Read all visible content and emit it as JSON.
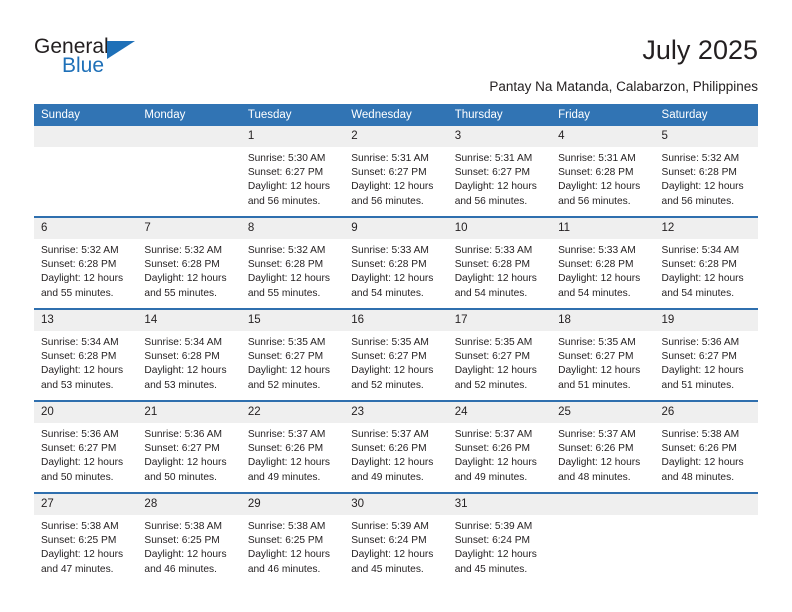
{
  "brand": {
    "name_part1": "General",
    "name_part2": "Blue",
    "triangle_icon": "triangle-icon",
    "accent_color": "#1e70b8"
  },
  "header": {
    "title": "July 2025",
    "subtitle": "Pantay Na Matanda, Calabarzon, Philippines",
    "header_bg_color": "#3174b4",
    "row_divider_color": "#2f6fae",
    "daynum_bg_color": "#efefef"
  },
  "weekday_headers": [
    "Sunday",
    "Monday",
    "Tuesday",
    "Wednesday",
    "Thursday",
    "Friday",
    "Saturday"
  ],
  "weeks": [
    [
      {
        "day": "",
        "empty": true
      },
      {
        "day": "",
        "empty": true
      },
      {
        "day": "1",
        "sunrise": "Sunrise: 5:30 AM",
        "sunset": "Sunset: 6:27 PM",
        "daylight1": "Daylight: 12 hours",
        "daylight2": "and 56 minutes."
      },
      {
        "day": "2",
        "sunrise": "Sunrise: 5:31 AM",
        "sunset": "Sunset: 6:27 PM",
        "daylight1": "Daylight: 12 hours",
        "daylight2": "and 56 minutes."
      },
      {
        "day": "3",
        "sunrise": "Sunrise: 5:31 AM",
        "sunset": "Sunset: 6:27 PM",
        "daylight1": "Daylight: 12 hours",
        "daylight2": "and 56 minutes."
      },
      {
        "day": "4",
        "sunrise": "Sunrise: 5:31 AM",
        "sunset": "Sunset: 6:28 PM",
        "daylight1": "Daylight: 12 hours",
        "daylight2": "and 56 minutes."
      },
      {
        "day": "5",
        "sunrise": "Sunrise: 5:32 AM",
        "sunset": "Sunset: 6:28 PM",
        "daylight1": "Daylight: 12 hours",
        "daylight2": "and 56 minutes."
      }
    ],
    [
      {
        "day": "6",
        "sunrise": "Sunrise: 5:32 AM",
        "sunset": "Sunset: 6:28 PM",
        "daylight1": "Daylight: 12 hours",
        "daylight2": "and 55 minutes."
      },
      {
        "day": "7",
        "sunrise": "Sunrise: 5:32 AM",
        "sunset": "Sunset: 6:28 PM",
        "daylight1": "Daylight: 12 hours",
        "daylight2": "and 55 minutes."
      },
      {
        "day": "8",
        "sunrise": "Sunrise: 5:32 AM",
        "sunset": "Sunset: 6:28 PM",
        "daylight1": "Daylight: 12 hours",
        "daylight2": "and 55 minutes."
      },
      {
        "day": "9",
        "sunrise": "Sunrise: 5:33 AM",
        "sunset": "Sunset: 6:28 PM",
        "daylight1": "Daylight: 12 hours",
        "daylight2": "and 54 minutes."
      },
      {
        "day": "10",
        "sunrise": "Sunrise: 5:33 AM",
        "sunset": "Sunset: 6:28 PM",
        "daylight1": "Daylight: 12 hours",
        "daylight2": "and 54 minutes."
      },
      {
        "day": "11",
        "sunrise": "Sunrise: 5:33 AM",
        "sunset": "Sunset: 6:28 PM",
        "daylight1": "Daylight: 12 hours",
        "daylight2": "and 54 minutes."
      },
      {
        "day": "12",
        "sunrise": "Sunrise: 5:34 AM",
        "sunset": "Sunset: 6:28 PM",
        "daylight1": "Daylight: 12 hours",
        "daylight2": "and 54 minutes."
      }
    ],
    [
      {
        "day": "13",
        "sunrise": "Sunrise: 5:34 AM",
        "sunset": "Sunset: 6:28 PM",
        "daylight1": "Daylight: 12 hours",
        "daylight2": "and 53 minutes."
      },
      {
        "day": "14",
        "sunrise": "Sunrise: 5:34 AM",
        "sunset": "Sunset: 6:28 PM",
        "daylight1": "Daylight: 12 hours",
        "daylight2": "and 53 minutes."
      },
      {
        "day": "15",
        "sunrise": "Sunrise: 5:35 AM",
        "sunset": "Sunset: 6:27 PM",
        "daylight1": "Daylight: 12 hours",
        "daylight2": "and 52 minutes."
      },
      {
        "day": "16",
        "sunrise": "Sunrise: 5:35 AM",
        "sunset": "Sunset: 6:27 PM",
        "daylight1": "Daylight: 12 hours",
        "daylight2": "and 52 minutes."
      },
      {
        "day": "17",
        "sunrise": "Sunrise: 5:35 AM",
        "sunset": "Sunset: 6:27 PM",
        "daylight1": "Daylight: 12 hours",
        "daylight2": "and 52 minutes."
      },
      {
        "day": "18",
        "sunrise": "Sunrise: 5:35 AM",
        "sunset": "Sunset: 6:27 PM",
        "daylight1": "Daylight: 12 hours",
        "daylight2": "and 51 minutes."
      },
      {
        "day": "19",
        "sunrise": "Sunrise: 5:36 AM",
        "sunset": "Sunset: 6:27 PM",
        "daylight1": "Daylight: 12 hours",
        "daylight2": "and 51 minutes."
      }
    ],
    [
      {
        "day": "20",
        "sunrise": "Sunrise: 5:36 AM",
        "sunset": "Sunset: 6:27 PM",
        "daylight1": "Daylight: 12 hours",
        "daylight2": "and 50 minutes."
      },
      {
        "day": "21",
        "sunrise": "Sunrise: 5:36 AM",
        "sunset": "Sunset: 6:27 PM",
        "daylight1": "Daylight: 12 hours",
        "daylight2": "and 50 minutes."
      },
      {
        "day": "22",
        "sunrise": "Sunrise: 5:37 AM",
        "sunset": "Sunset: 6:26 PM",
        "daylight1": "Daylight: 12 hours",
        "daylight2": "and 49 minutes."
      },
      {
        "day": "23",
        "sunrise": "Sunrise: 5:37 AM",
        "sunset": "Sunset: 6:26 PM",
        "daylight1": "Daylight: 12 hours",
        "daylight2": "and 49 minutes."
      },
      {
        "day": "24",
        "sunrise": "Sunrise: 5:37 AM",
        "sunset": "Sunset: 6:26 PM",
        "daylight1": "Daylight: 12 hours",
        "daylight2": "and 49 minutes."
      },
      {
        "day": "25",
        "sunrise": "Sunrise: 5:37 AM",
        "sunset": "Sunset: 6:26 PM",
        "daylight1": "Daylight: 12 hours",
        "daylight2": "and 48 minutes."
      },
      {
        "day": "26",
        "sunrise": "Sunrise: 5:38 AM",
        "sunset": "Sunset: 6:26 PM",
        "daylight1": "Daylight: 12 hours",
        "daylight2": "and 48 minutes."
      }
    ],
    [
      {
        "day": "27",
        "sunrise": "Sunrise: 5:38 AM",
        "sunset": "Sunset: 6:25 PM",
        "daylight1": "Daylight: 12 hours",
        "daylight2": "and 47 minutes."
      },
      {
        "day": "28",
        "sunrise": "Sunrise: 5:38 AM",
        "sunset": "Sunset: 6:25 PM",
        "daylight1": "Daylight: 12 hours",
        "daylight2": "and 46 minutes."
      },
      {
        "day": "29",
        "sunrise": "Sunrise: 5:38 AM",
        "sunset": "Sunset: 6:25 PM",
        "daylight1": "Daylight: 12 hours",
        "daylight2": "and 46 minutes."
      },
      {
        "day": "30",
        "sunrise": "Sunrise: 5:39 AM",
        "sunset": "Sunset: 6:24 PM",
        "daylight1": "Daylight: 12 hours",
        "daylight2": "and 45 minutes."
      },
      {
        "day": "31",
        "sunrise": "Sunrise: 5:39 AM",
        "sunset": "Sunset: 6:24 PM",
        "daylight1": "Daylight: 12 hours",
        "daylight2": "and 45 minutes."
      },
      {
        "day": "",
        "empty": true
      },
      {
        "day": "",
        "empty": true
      }
    ]
  ]
}
